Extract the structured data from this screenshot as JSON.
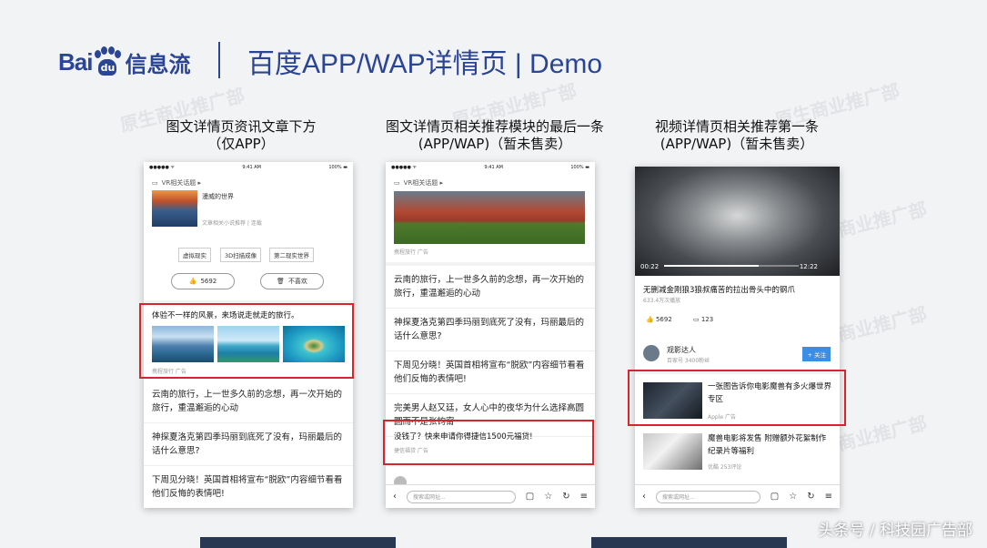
{
  "header": {
    "logo_bai": "Bai",
    "logo_du": "du",
    "logo_xxl": "信息流",
    "title": "百度APP/WAP详情页 | Demo"
  },
  "watermark": "原生商业推广部",
  "columns": [
    {
      "caption_line1": "图文详情页资讯文章下方",
      "caption_line2": "（仅APP）"
    },
    {
      "caption_line1": "图文详情页相关推荐模块的最后一条",
      "caption_line2": "(APP/WAP)（暂未售卖）"
    },
    {
      "caption_line1": "视频详情页相关推荐第一条",
      "caption_line2": "(APP/WAP)（暂未售卖）"
    }
  ],
  "status": {
    "carrier": "●●●●● ᯤ",
    "time": "9:41 AM",
    "battery": "100% ▬"
  },
  "phone1": {
    "topic": "VR相关话题 ▸",
    "article_title": "漫威的世界",
    "article_meta": "文章相关小说推荐 | 连载",
    "tags": [
      "虚拟现实",
      "3D扫描成像",
      "第二现实世界"
    ],
    "like_count": "5692",
    "dislike_label": "不喜欢",
    "ad_title": "体验不一样的风景，来场说走就走的旅行。",
    "ad_source": "携程旅行  广告",
    "items": [
      "云南的旅行，上一世多久前的念想，再一次开始的旅行，重温邂逅的心动",
      "神探夏洛克第四季玛丽到底死了没有，玛丽最后的话什么意思?",
      "下周见分晓！英国首相将宣布“脱欧”内容细节看看他们反悔的表情吧!"
    ]
  },
  "phone2": {
    "topic": "VR相关话题 ▸",
    "img_source": "携程旅行  广告",
    "items": [
      "云南的旅行，上一世多久前的念想，再一次开始的旅行，重温邂逅的心动",
      "神探夏洛克第四季玛丽到底死了没有，玛丽最后的话什么意思?",
      "下周见分晓！英国首相将宣布“脱欧”内容细节看看他们反悔的表情吧!",
      "完美男人赵又廷，女人心中的夜华为什么选择高圆圆而不是张钧甯"
    ],
    "ad_title": "没钱了？快来申请你得捷信1500元福贷!",
    "ad_source": "捷信福贷  广告",
    "search_placeholder": "搜索或网址..."
  },
  "phone3": {
    "time_elapsed": "00:22",
    "time_total": "12:22",
    "video_title": "无删减金刚狼3狼叔痛苦的拉出骨头中的钢爪",
    "video_views": "633.4万次播放",
    "like_count": "5692",
    "comment_count": "123",
    "author": "观影达人",
    "author_meta": "百家号   3400粉丝",
    "follow_label": "+ 关注",
    "ad_title": "一张图告诉你电影魔兽有多火爆世界专区",
    "ad_source": "Apple  广告",
    "item2_title": "魔兽电影将发售 附赠额外花絮制作纪录片等福利",
    "item2_meta": "优酷   253评论",
    "search_placeholder": "搜索或网址..."
  },
  "credit": "头条号 / 科技园广告部"
}
